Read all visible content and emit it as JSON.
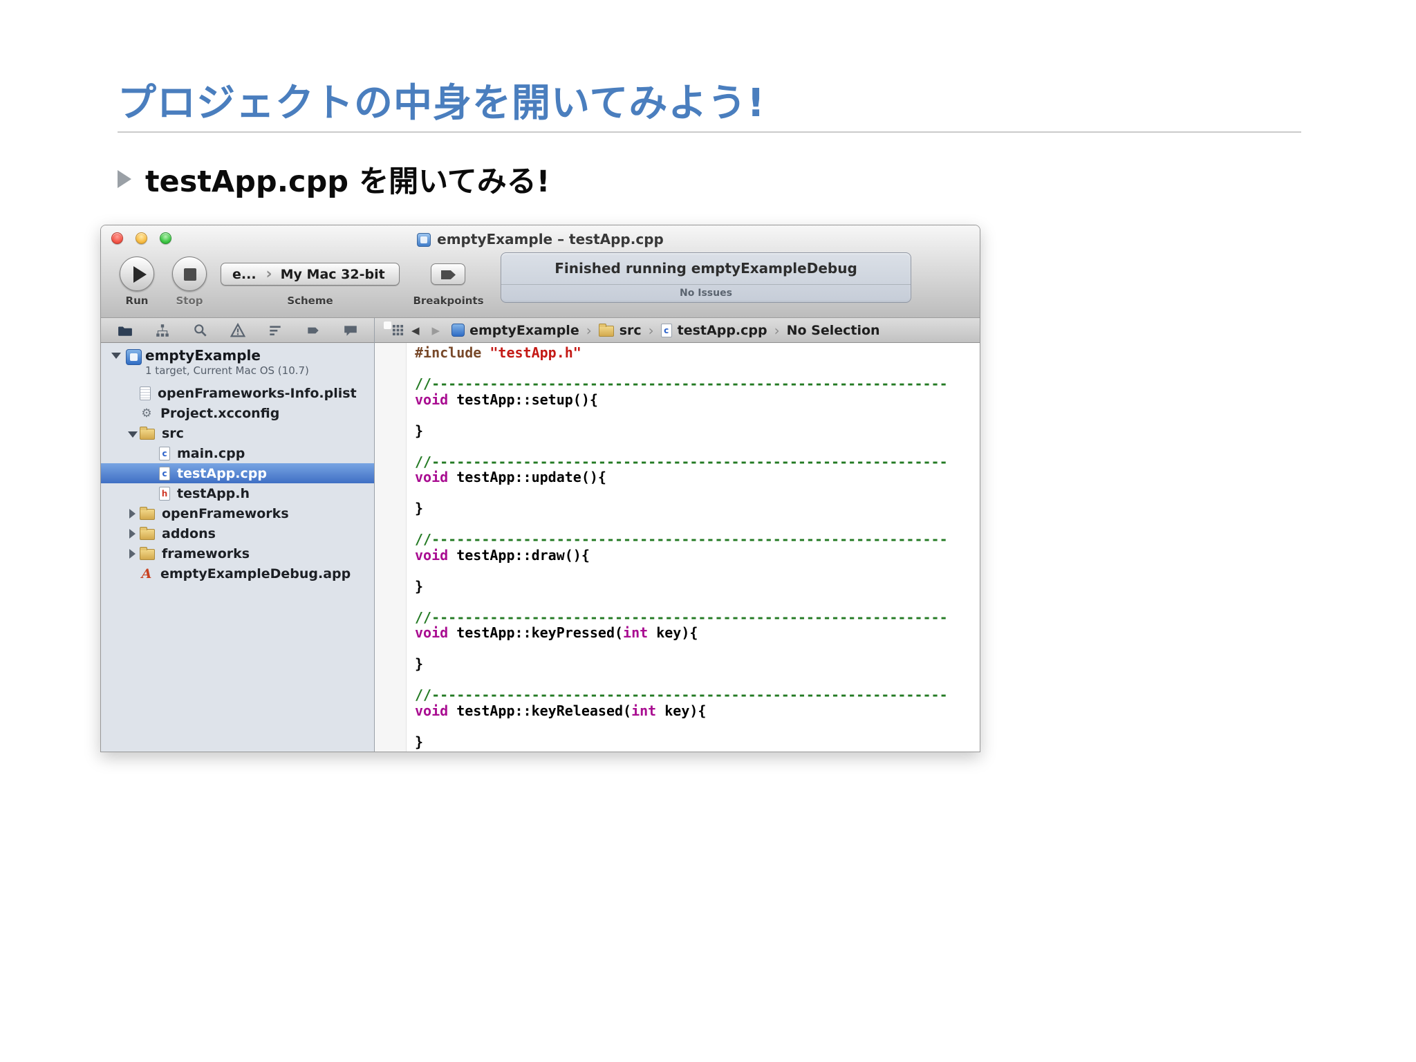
{
  "colors": {
    "title_accent": "#4a7ebe",
    "selection_blue": "#3f6fc4",
    "comment_green": "#237a23",
    "keyword_magenta": "#a90d91",
    "string_red": "#c41a16"
  },
  "slide": {
    "title": "プロジェクトの中身を開いてみよう!",
    "bullet": "testApp.cpp を開いてみる!"
  },
  "window": {
    "title": "emptyExample – testApp.cpp",
    "toolbar": {
      "run_label": "Run",
      "stop_label": "Stop",
      "scheme_label": "Scheme",
      "breakpoints_label": "Breakpoints",
      "scheme_left": "e...",
      "scheme_right": "My Mac 32-bit",
      "status_line1": "Finished running emptyExampleDebug",
      "status_line2": "No Issues"
    },
    "navigator": {
      "icons": [
        "project-navigator-icon",
        "symbol-navigator-icon",
        "search-navigator-icon",
        "issue-navigator-icon",
        "debug-navigator-icon",
        "breakpoint-navigator-icon",
        "log-navigator-icon"
      ]
    },
    "jumpbar": {
      "crumbs": [
        "emptyExample",
        "src",
        "testApp.cpp",
        "No Selection"
      ]
    },
    "sidebar": {
      "project": {
        "label": "emptyExample",
        "subtitle": "1 target, Current Mac OS (10.7)"
      },
      "items": [
        {
          "label": "openFrameworks-Info.plist",
          "icon": "plist",
          "indent": 1
        },
        {
          "label": "Project.xcconfig",
          "icon": "gear",
          "indent": 1
        },
        {
          "label": "src",
          "icon": "folder",
          "indent": 1,
          "disclosure": "open"
        },
        {
          "label": "main.cpp",
          "icon": "cpp",
          "indent": 2
        },
        {
          "label": "testApp.cpp",
          "icon": "cpp",
          "indent": 2,
          "selected": true
        },
        {
          "label": "testApp.h",
          "icon": "h",
          "indent": 2
        },
        {
          "label": "openFrameworks",
          "icon": "folder",
          "indent": 1,
          "disclosure": "closed"
        },
        {
          "label": "addons",
          "icon": "folder",
          "indent": 1,
          "disclosure": "closed"
        },
        {
          "label": "frameworks",
          "icon": "folder",
          "indent": 1,
          "disclosure": "closed"
        },
        {
          "label": "emptyExampleDebug.app",
          "icon": "app",
          "indent": 1
        }
      ]
    },
    "editor": {
      "lines": [
        [
          [
            "pre",
            "#include "
          ],
          [
            "str",
            "\"testApp.h\""
          ]
        ],
        [],
        [
          [
            "com",
            "//--------------------------------------------------------------"
          ]
        ],
        [
          [
            "kw",
            "void"
          ],
          [
            "pl",
            " testApp::setup(){"
          ]
        ],
        [],
        [
          [
            "pl",
            "}"
          ]
        ],
        [],
        [
          [
            "com",
            "//--------------------------------------------------------------"
          ]
        ],
        [
          [
            "kw",
            "void"
          ],
          [
            "pl",
            " testApp::update(){"
          ]
        ],
        [],
        [
          [
            "pl",
            "}"
          ]
        ],
        [],
        [
          [
            "com",
            "//--------------------------------------------------------------"
          ]
        ],
        [
          [
            "kw",
            "void"
          ],
          [
            "pl",
            " testApp::draw(){"
          ]
        ],
        [],
        [
          [
            "pl",
            "}"
          ]
        ],
        [],
        [
          [
            "com",
            "//--------------------------------------------------------------"
          ]
        ],
        [
          [
            "kw",
            "void"
          ],
          [
            "pl",
            " testApp::keyPressed("
          ],
          [
            "kw",
            "int"
          ],
          [
            "pl",
            " key){"
          ]
        ],
        [],
        [
          [
            "pl",
            "}"
          ]
        ],
        [],
        [
          [
            "com",
            "//--------------------------------------------------------------"
          ]
        ],
        [
          [
            "kw",
            "void"
          ],
          [
            "pl",
            " testApp::keyReleased("
          ],
          [
            "kw",
            "int"
          ],
          [
            "pl",
            " key){"
          ]
        ],
        [],
        [
          [
            "pl",
            "}"
          ]
        ]
      ]
    }
  }
}
